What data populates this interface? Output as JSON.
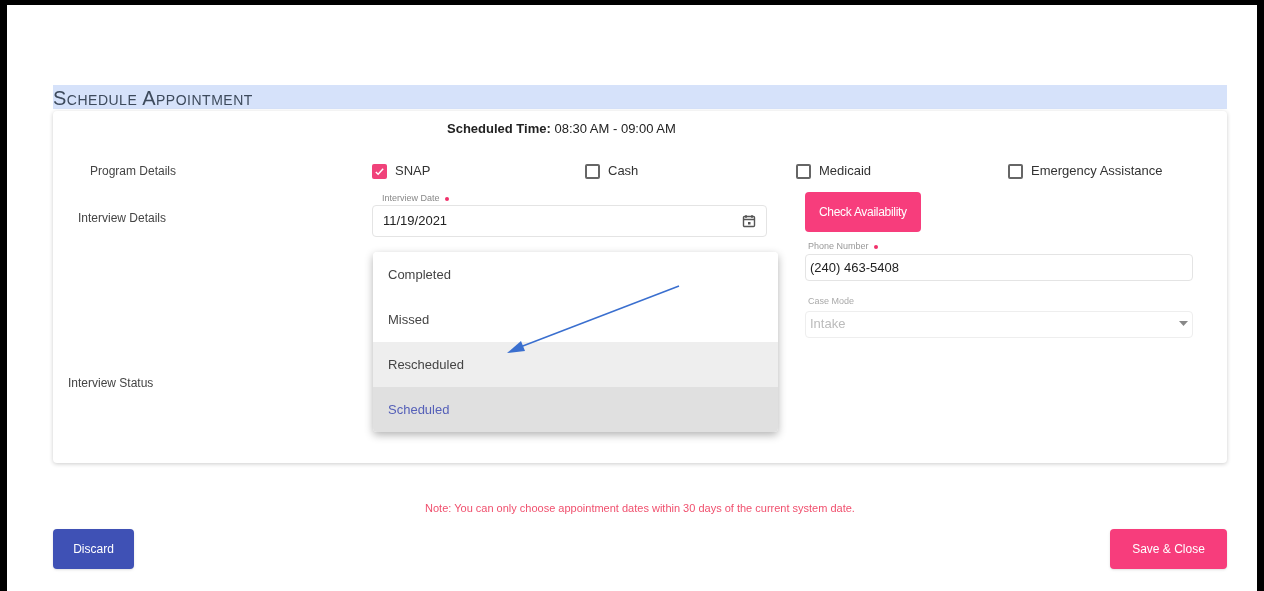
{
  "heading": "Schedule Appointment",
  "scheduled_time": {
    "label": "Scheduled Time:",
    "value": "08:30 AM - 09:00 AM"
  },
  "program_details": {
    "label": "Program Details",
    "options": [
      {
        "label": "SNAP",
        "checked": true
      },
      {
        "label": "Cash",
        "checked": false
      },
      {
        "label": "Medicaid",
        "checked": false
      },
      {
        "label": "Emergency Assistance",
        "checked": false
      }
    ]
  },
  "interview_details": {
    "label": "Interview Details",
    "interview_date": {
      "label": "Interview Date",
      "required": true,
      "value": "11/19/2021"
    },
    "check_availability": "Check Availability",
    "phone_number": {
      "label": "Phone Number",
      "required": true,
      "value": "(240) 463-5408"
    },
    "case_mode": {
      "label": "Case Mode",
      "value": "Intake",
      "disabled": true
    }
  },
  "interview_status": {
    "label": "Interview Status",
    "menu": [
      {
        "label": "Completed",
        "selected": false,
        "hovered": false
      },
      {
        "label": "Missed",
        "selected": false,
        "hovered": false
      },
      {
        "label": "Rescheduled",
        "selected": false,
        "hovered": true
      },
      {
        "label": "Scheduled",
        "selected": true,
        "hovered": false
      }
    ]
  },
  "note": "Note: You can only choose appointment dates within 30 days of the current system date.",
  "buttons": {
    "discard": "Discard",
    "save": "Save & Close"
  }
}
